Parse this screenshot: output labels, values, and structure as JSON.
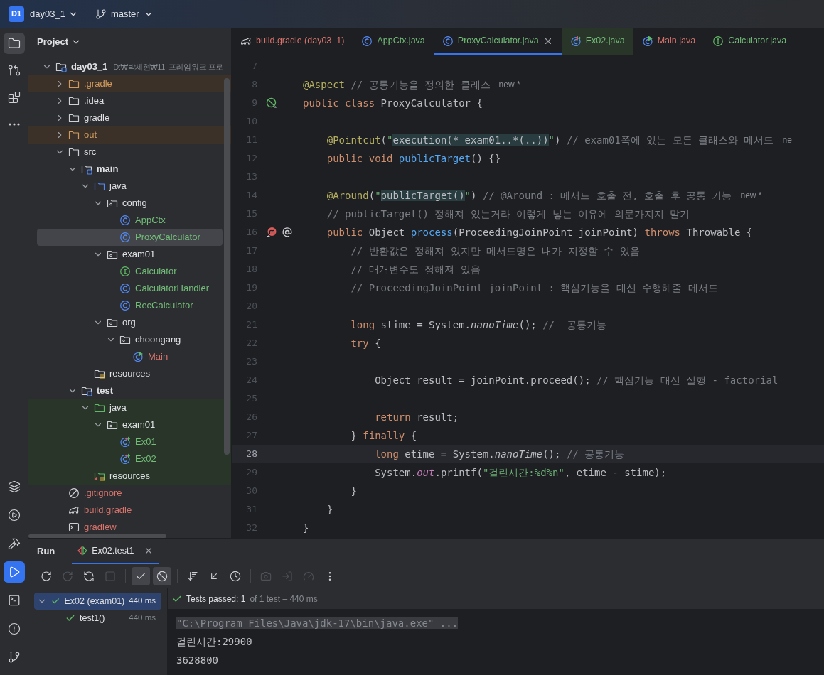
{
  "toolbar": {
    "project_badge": "D1",
    "project": "day03_1",
    "branch": "master"
  },
  "tool_windows_top": [
    {
      "kind": "project",
      "selected": true
    },
    {
      "kind": "commit",
      "selected": false
    },
    {
      "kind": "structure",
      "selected": false
    },
    {
      "kind": "more",
      "selected": false
    }
  ],
  "tool_windows_bottom": [
    {
      "kind": "layers",
      "selected": false
    },
    {
      "kind": "services",
      "selected": false
    },
    {
      "kind": "build",
      "selected": false
    },
    {
      "kind": "run",
      "selected": true
    },
    {
      "kind": "terminal",
      "selected": false
    },
    {
      "kind": "problems",
      "selected": false
    },
    {
      "kind": "git",
      "selected": false
    }
  ],
  "project": {
    "title": "Project",
    "tree": [
      {
        "label": "day03_1",
        "path": "D:₩박세현₩11. 프레임워크 프로",
        "kind": "module",
        "ignored": false,
        "expanded": true,
        "selected": false,
        "children": [
          {
            "label": ".gradle",
            "kind": "folder",
            "color": "#d09a5e",
            "ignored": true,
            "expanded": false,
            "selected": false
          },
          {
            "label": ".idea",
            "kind": "folder",
            "ignored": false,
            "expanded": false,
            "selected": false
          },
          {
            "label": "gradle",
            "kind": "folder",
            "ignored": false,
            "expanded": false,
            "selected": false
          },
          {
            "label": "out",
            "kind": "folder",
            "color": "#d09a5e",
            "ignored": true,
            "expanded": false,
            "selected": false
          },
          {
            "label": "src",
            "kind": "folder",
            "ignored": false,
            "expanded": true,
            "selected": false,
            "children": [
              {
                "label": "main",
                "kind": "module",
                "ignored": false,
                "expanded": true,
                "selected": false,
                "children": [
                  {
                    "label": "java",
                    "kind": "source",
                    "ignored": false,
                    "expanded": true,
                    "selected": false,
                    "children": [
                      {
                        "label": "config",
                        "kind": "package",
                        "ignored": false,
                        "expanded": true,
                        "selected": false,
                        "children": [
                          {
                            "label": "AppCtx",
                            "kind": "class",
                            "color": "#73bd79",
                            "ignored": false,
                            "selected": false
                          },
                          {
                            "label": "ProxyCalculator",
                            "kind": "class",
                            "color": "#73bd79",
                            "ignored": false,
                            "selected": true
                          }
                        ]
                      },
                      {
                        "label": "exam01",
                        "kind": "package",
                        "ignored": false,
                        "expanded": true,
                        "selected": false,
                        "children": [
                          {
                            "label": "Calculator",
                            "kind": "interface",
                            "color": "#73bd79",
                            "ignored": false,
                            "selected": false
                          },
                          {
                            "label": "CalculatorHandler",
                            "kind": "class",
                            "color": "#73bd79",
                            "ignored": false,
                            "selected": false
                          },
                          {
                            "label": "RecCalculator",
                            "kind": "class",
                            "color": "#73bd79",
                            "ignored": false,
                            "selected": false
                          }
                        ]
                      },
                      {
                        "label": "org",
                        "kind": "package",
                        "ignored": false,
                        "expanded": true,
                        "selected": false,
                        "children": [
                          {
                            "label": "choongang",
                            "kind": "package",
                            "ignored": false,
                            "expanded": true,
                            "selected": false,
                            "children": [
                              {
                                "label": "Main",
                                "kind": "main-class",
                                "color": "#d9736c",
                                "ignored": false,
                                "selected": false
                              }
                            ]
                          }
                        ]
                      }
                    ]
                  },
                  {
                    "label": "resources",
                    "kind": "resources",
                    "ignored": false,
                    "selected": false
                  }
                ]
              },
              {
                "label": "test",
                "kind": "module",
                "ignored": false,
                "expanded": true,
                "selected": false,
                "children": [
                  {
                    "label": "java",
                    "kind": "test-source",
                    "ignored": false,
                    "expanded": true,
                    "selected": false,
                    "children": [
                      {
                        "label": "exam01",
                        "kind": "package",
                        "ignored": false,
                        "expanded": true,
                        "selected": false,
                        "children": [
                          {
                            "label": "Ex01",
                            "kind": "test-class",
                            "color": "#73bd79",
                            "ignored": false,
                            "selected": false
                          },
                          {
                            "label": "Ex02",
                            "kind": "test-class",
                            "color": "#73bd79",
                            "ignored": false,
                            "selected": false
                          }
                        ]
                      }
                    ]
                  },
                  {
                    "label": "resources",
                    "kind": "test-resources",
                    "ignored": false,
                    "selected": false
                  }
                ]
              }
            ]
          },
          {
            "label": ".gitignore",
            "kind": "ignore-file",
            "color": "#d9736c",
            "ignored": false,
            "selected": false
          },
          {
            "label": "build.gradle",
            "kind": "gradle-file",
            "color": "#d9736c",
            "ignored": false,
            "selected": false
          },
          {
            "label": "gradlew",
            "kind": "script-file",
            "color": "#d9736c",
            "ignored": false,
            "selected": false
          }
        ]
      }
    ]
  },
  "editor": {
    "tabs": [
      {
        "label": "build.gradle (day03_1)",
        "kind": "gradle-file",
        "color": "#d9736c",
        "selected": false
      },
      {
        "label": "AppCtx.java",
        "kind": "class",
        "color": "#73bd79",
        "selected": false
      },
      {
        "label": "ProxyCalculator.java",
        "kind": "class",
        "color": "#73bd79",
        "selected": true
      },
      {
        "label": "Ex02.java",
        "kind": "test-class",
        "color": "#73bd79",
        "selected": false
      },
      {
        "label": "Main.java",
        "kind": "main-class",
        "color": "#d9736c",
        "selected": false
      },
      {
        "label": "Calculator.java",
        "kind": "interface",
        "color": "#73bd79",
        "selected": false
      }
    ],
    "lines": [
      {
        "number": "7",
        "current": false
      },
      {
        "number": "8",
        "current": false,
        "tokens": [
          {
            "kind": "ann",
            "text": "@Aspect"
          },
          {
            "kind": "cmt",
            "text": " // 공통기능을 정의한 클래스"
          }
        ],
        "hint": "new *"
      },
      {
        "number": "9",
        "current": false,
        "gutter": [
          {
            "kind": "bean"
          }
        ],
        "tokens": [
          {
            "kind": "kw",
            "text": "public class "
          },
          {
            "kind": "plain",
            "text": "ProxyCalculator {"
          }
        ]
      },
      {
        "number": "10",
        "current": false
      },
      {
        "number": "11",
        "current": false,
        "tokens": [
          {
            "kind": "ann",
            "text": "    @Pointcut"
          },
          {
            "kind": "plain",
            "text": "("
          },
          {
            "kind": "str",
            "text": "\""
          },
          {
            "kind": "inj",
            "text": "execution(* exam01..*(..))"
          },
          {
            "kind": "str",
            "text": "\""
          },
          {
            "kind": "plain",
            "text": ") "
          },
          {
            "kind": "cmt",
            "text": "// exam01쪽에 있는 모든 클래스와 메서드"
          }
        ],
        "hint": "ne"
      },
      {
        "number": "12",
        "current": false,
        "tokens": [
          {
            "kind": "kw",
            "text": "    public void "
          },
          {
            "kind": "decl",
            "text": "publicTarget"
          },
          {
            "kind": "plain",
            "text": "() {}"
          }
        ]
      },
      {
        "number": "13",
        "current": false
      },
      {
        "number": "14",
        "current": false,
        "tokens": [
          {
            "kind": "ann",
            "text": "    @Around"
          },
          {
            "kind": "plain",
            "text": "("
          },
          {
            "kind": "str",
            "text": "\""
          },
          {
            "kind": "inj",
            "text": "publicTarget()"
          },
          {
            "kind": "str",
            "text": "\""
          },
          {
            "kind": "plain",
            "text": ") "
          },
          {
            "kind": "cmt",
            "text": "// @Around : 메서드 호출 전, 호출 후 공통 기능"
          }
        ],
        "hint": "new *"
      },
      {
        "number": "15",
        "current": false,
        "tokens": [
          {
            "kind": "cmt",
            "text": "    // publicTarget() 정해져 있는거라 이렇게 넣는 이유에 의문가지지 말기"
          }
        ]
      },
      {
        "number": "16",
        "current": false,
        "gutter": [
          {
            "kind": "override"
          },
          {
            "kind": "aspect"
          }
        ],
        "tokens": [
          {
            "kind": "kw",
            "text": "    public "
          },
          {
            "kind": "plain",
            "text": "Object "
          },
          {
            "kind": "decl",
            "text": "process"
          },
          {
            "kind": "plain",
            "text": "(ProceedingJoinPoint joinPoint) "
          },
          {
            "kind": "kw",
            "text": "throws "
          },
          {
            "kind": "plain",
            "text": "Throwable {"
          }
        ]
      },
      {
        "number": "17",
        "current": false,
        "tokens": [
          {
            "kind": "cmt",
            "text": "        // 반환값은 정해져 있지만 메서드명은 내가 지정할 수 있음"
          }
        ]
      },
      {
        "number": "18",
        "current": false,
        "tokens": [
          {
            "kind": "cmt",
            "text": "        // 매개변수도 정해져 있음"
          }
        ]
      },
      {
        "number": "19",
        "current": false,
        "tokens": [
          {
            "kind": "cmt",
            "text": "        // ProceedingJoinPoint joinPoint : 핵심기능을 대신 수행해줄 메서드"
          }
        ]
      },
      {
        "number": "20",
        "current": false
      },
      {
        "number": "21",
        "current": false,
        "tokens": [
          {
            "kind": "kw",
            "text": "        long "
          },
          {
            "kind": "plain",
            "text": "stime = System."
          },
          {
            "kind": "call",
            "text": "nanoTime"
          },
          {
            "kind": "plain",
            "text": "(); "
          },
          {
            "kind": "cmt",
            "text": "//  공통기능"
          }
        ]
      },
      {
        "number": "22",
        "current": false,
        "tokens": [
          {
            "kind": "kw",
            "text": "        try "
          },
          {
            "kind": "plain",
            "text": "{"
          }
        ]
      },
      {
        "number": "23",
        "current": false
      },
      {
        "number": "24",
        "current": false,
        "tokens": [
          {
            "kind": "plain",
            "text": "            Object result = joinPoint.proceed(); "
          },
          {
            "kind": "cmt",
            "text": "// 핵심기능 대신 실행 - factorial"
          }
        ]
      },
      {
        "number": "25",
        "current": false
      },
      {
        "number": "26",
        "current": false,
        "tokens": [
          {
            "kind": "kw",
            "text": "            return "
          },
          {
            "kind": "plain",
            "text": "result;"
          }
        ]
      },
      {
        "number": "27",
        "current": false,
        "tokens": [
          {
            "kind": "plain",
            "text": "        } "
          },
          {
            "kind": "kw",
            "text": "finally "
          },
          {
            "kind": "plain",
            "text": "{"
          }
        ]
      },
      {
        "number": "28",
        "current": true,
        "tokens": [
          {
            "kind": "kw",
            "text": "            long "
          },
          {
            "kind": "plain",
            "text": "etime = System."
          },
          {
            "kind": "call",
            "text": "nanoTime"
          },
          {
            "kind": "plain",
            "text": "(); "
          },
          {
            "kind": "cmt",
            "text": "// 공통기능"
          }
        ]
      },
      {
        "number": "29",
        "current": false,
        "tokens": [
          {
            "kind": "plain",
            "text": "            System."
          },
          {
            "kind": "field",
            "text": "out"
          },
          {
            "kind": "plain",
            "text": ".printf("
          },
          {
            "kind": "str",
            "text": "\"걸린시간:%d%n\""
          },
          {
            "kind": "plain",
            "text": ", etime - stime);"
          }
        ]
      },
      {
        "number": "30",
        "current": false,
        "tokens": [
          {
            "kind": "plain",
            "text": "        }"
          }
        ]
      },
      {
        "number": "31",
        "current": false,
        "tokens": [
          {
            "kind": "plain",
            "text": "    }"
          }
        ]
      },
      {
        "number": "32",
        "current": false,
        "tokens": [
          {
            "kind": "plain",
            "text": "}"
          }
        ]
      }
    ]
  },
  "run_panel": {
    "title": "Run",
    "tabs": [
      {
        "label": "Ex02.test1",
        "selected": true
      }
    ],
    "actions": [
      {
        "kind": "rerun",
        "separator_before": false,
        "disabled": false,
        "on": false
      },
      {
        "kind": "rerun-failed",
        "separator_before": false,
        "disabled": true,
        "on": false
      },
      {
        "kind": "toggle-auto-test",
        "separator_before": false,
        "disabled": false,
        "on": false
      },
      {
        "kind": "stop",
        "separator_before": false,
        "disabled": true,
        "on": false
      },
      {
        "kind": "show-passed",
        "separator_before": true,
        "disabled": false,
        "on": true
      },
      {
        "kind": "show-ignored",
        "separator_before": false,
        "disabled": false,
        "on": true
      },
      {
        "kind": "sort",
        "separator_before": true,
        "disabled": false,
        "on": false
      },
      {
        "kind": "collapse",
        "separator_before": false,
        "disabled": false,
        "on": false
      },
      {
        "kind": "history",
        "separator_before": false,
        "disabled": false,
        "on": false
      },
      {
        "kind": "screenshot",
        "separator_before": true,
        "disabled": true,
        "on": false
      },
      {
        "kind": "import",
        "separator_before": false,
        "disabled": true,
        "on": false
      },
      {
        "kind": "gauge",
        "separator_before": false,
        "disabled": true,
        "on": false
      },
      {
        "kind": "more",
        "separator_before": false,
        "disabled": false,
        "on": false
      }
    ],
    "tests": [
      {
        "label": "Ex02 (exam01)",
        "time": "440 ms",
        "passed": true,
        "expanded": true,
        "selected": true,
        "children": [
          {
            "label": "test1()",
            "time": "440 ms",
            "passed": true,
            "selected": false
          }
        ]
      }
    ],
    "summary": "Tests passed: 1",
    "detail": "of 1 test – 440 ms",
    "console": [
      {
        "kind": "command",
        "text": "\"C:\\Program Files\\Java\\jdk-17\\bin\\java.exe\" ..."
      },
      {
        "kind": "output",
        "text": "걸린시간:29900"
      },
      {
        "kind": "output",
        "text": "3628800"
      }
    ]
  }
}
